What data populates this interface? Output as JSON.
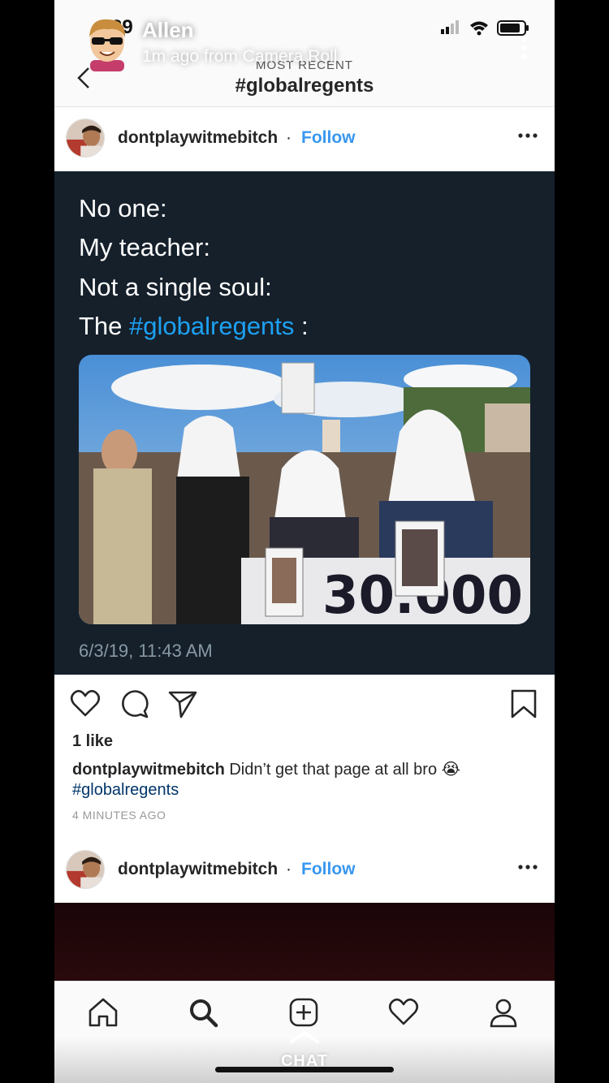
{
  "snap": {
    "time": "29",
    "sender_name": "Allen",
    "meta": "1m ago from Camera Roll",
    "chat_label": "CHAT"
  },
  "header": {
    "subtitle": "MOST RECENT",
    "title": "#globalregents"
  },
  "posts": [
    {
      "username": "dontplaywitmebitch",
      "separator": "·",
      "follow_label": "Follow"
    },
    {
      "username": "dontplaywitmebitch",
      "separator": "·",
      "follow_label": "Follow"
    }
  ],
  "tweet": {
    "lines": [
      "No one:",
      "My teacher:",
      "Not a single soul:"
    ],
    "last_prefix": "The ",
    "last_hashtag": "#globalregents",
    "last_suffix": " :",
    "date": "6/3/19, 11:43 AM",
    "banner_text": "30.000"
  },
  "post_details": {
    "likes": "1 like",
    "caption_user": "dontplaywitmebitch",
    "caption_text": " Didn’t get that page at all bro 😭",
    "caption_tag": "#globalregents",
    "time_ago": "4 MINUTES AGO"
  },
  "colors": {
    "follow_blue": "#3897f0",
    "tweet_bg": "#15202b",
    "twitter_blue": "#1da1f2"
  },
  "icons": {
    "back": "chevron-left-icon",
    "more": "more-horizontal-icon",
    "like": "heart-icon",
    "comment": "comment-icon",
    "share": "send-icon",
    "save": "bookmark-icon",
    "home": "home-icon",
    "search": "search-icon",
    "add": "add-post-icon",
    "activity": "heart-icon",
    "profile": "profile-icon"
  }
}
